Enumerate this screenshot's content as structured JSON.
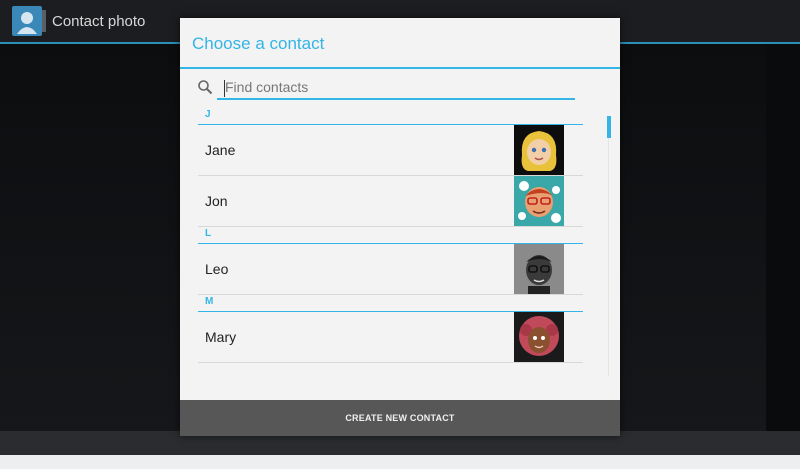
{
  "app": {
    "title": "Contact photo",
    "icon": "contact-card-icon"
  },
  "dialog": {
    "title": "Choose a contact",
    "search": {
      "placeholder": "Find contacts",
      "value": "",
      "icon": "search-icon"
    },
    "sections": [
      {
        "letter": "J",
        "contacts": [
          {
            "name": "Jane"
          },
          {
            "name": "Jon"
          }
        ]
      },
      {
        "letter": "L",
        "contacts": [
          {
            "name": "Leo"
          }
        ]
      },
      {
        "letter": "M",
        "contacts": [
          {
            "name": "Mary"
          }
        ]
      }
    ],
    "create_button_label": "CREATE NEW CONTACT"
  },
  "colors": {
    "accent": "#33b5e5",
    "button_bg": "#575757",
    "dialog_bg": "#f3f3f3"
  }
}
